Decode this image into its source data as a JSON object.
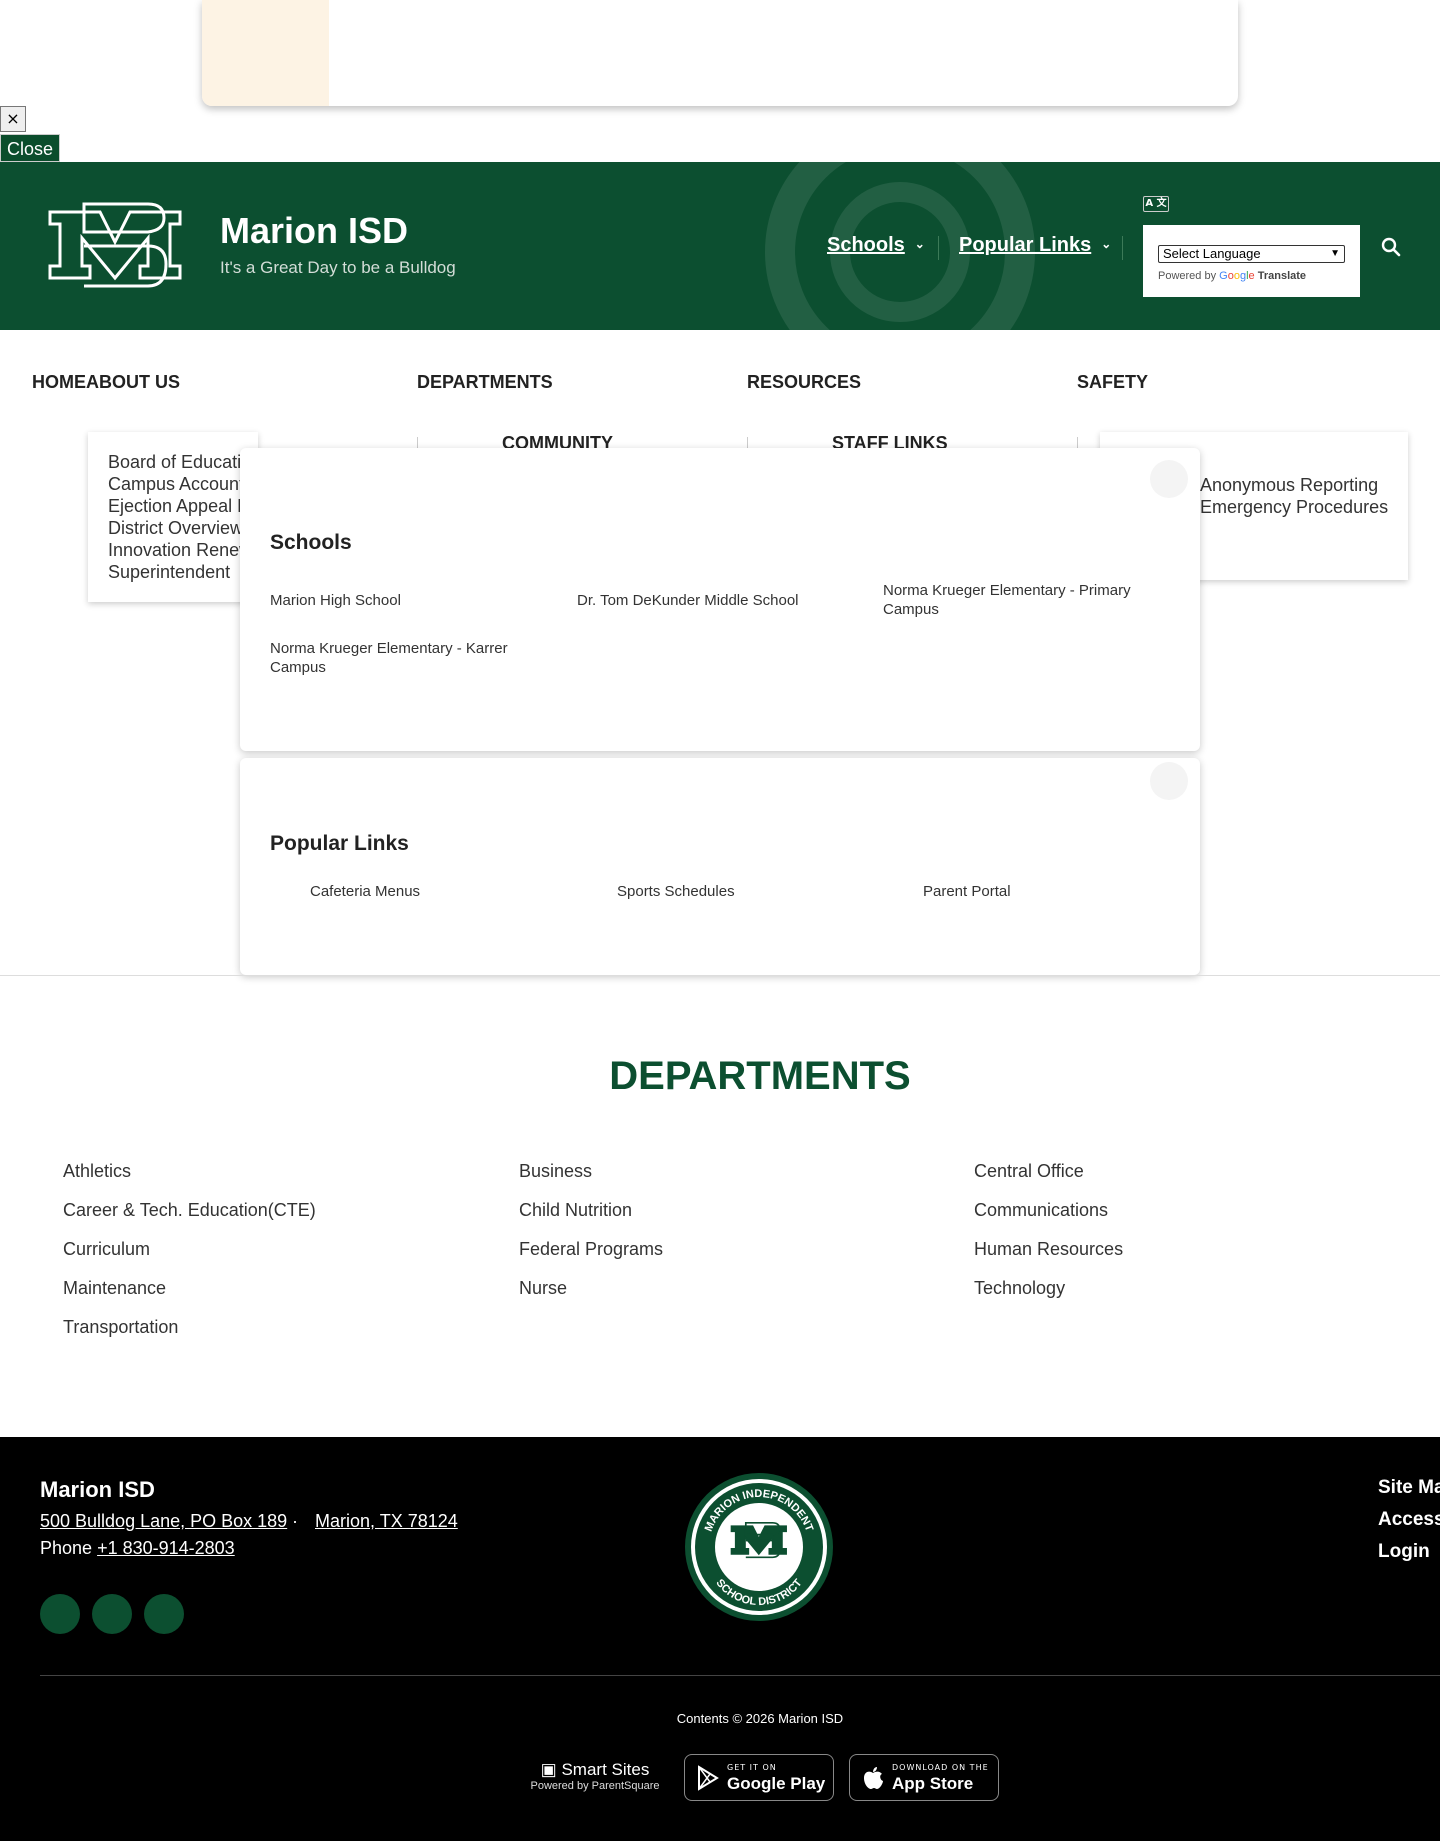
{
  "alert": {
    "close_x": "×",
    "close_label": "Close"
  },
  "header": {
    "site_name": "Marion ISD",
    "tagline": "It's a Great Day to be a Bulldog",
    "nav": [
      {
        "label": "Schools",
        "icon": "chevron-down-icon"
      },
      {
        "label": "Popular Links",
        "icon": "chevron-down-icon"
      }
    ],
    "translate": {
      "icon_text": "A 文",
      "select_value": "Select Language",
      "powered_by": "Powered by",
      "google": [
        "G",
        "o",
        "o",
        "g",
        "l",
        "e"
      ],
      "translate_label": "Translate"
    },
    "colors": {
      "header_bg": "#0c4f30",
      "accent": "#0c4f30"
    }
  },
  "main_nav": {
    "row1": [
      "HOMEABOUT US",
      "DEPARTMENTS",
      "RESOURCES",
      "SAFETY"
    ],
    "row2": [
      "COMMUNITY",
      "STAFF LINKS"
    ]
  },
  "about_dropdown": [
    "Board of Education",
    "Campus Accountability",
    "Ejection Appeal Process",
    "District Overview",
    "Innovation Renewal",
    "Superintendent"
  ],
  "safety_dropdown": [
    "Anonymous Reporting",
    "Emergency Procedures"
  ],
  "schools_panel": {
    "title": "Schools",
    "links": [
      "Marion High School",
      "Dr. Tom DeKunder Middle School",
      "Norma Krueger Elementary - Primary Campus",
      "Norma Krueger Elementary - Karrer Campus"
    ]
  },
  "popular_panel": {
    "title": "Popular Links",
    "links": [
      "Cafeteria Menus",
      "Sports Schedules",
      "Parent Portal"
    ]
  },
  "departments": {
    "title": "DEPARTMENTS",
    "col1": [
      "Athletics",
      "Career & Tech. Education(CTE)",
      "Curriculum",
      "Maintenance",
      "Transportation"
    ],
    "col2": [
      "Business",
      "Child Nutrition",
      "Federal Programs",
      "Nurse"
    ],
    "col3": [
      "Central Office",
      "Communications",
      "Human Resources",
      "Technology"
    ]
  },
  "footer": {
    "name": "Marion ISD",
    "address1": "500 Bulldog Lane, PO Box 189",
    "separator": "·",
    "address2": "Marion, TX 78124",
    "phone_label": "Phone",
    "phone": "+1 830-914-2803",
    "links": [
      "Site Map",
      "Accessibility",
      "Login"
    ],
    "seal_text_top": "MARION INDEPENDENT",
    "seal_text_bottom": "SCHOOL DISTRICT",
    "copyright": "Contents © 2026 Marion ISD",
    "smart_sites": "Smart Sites",
    "powered_by": "Powered by ParentSquare",
    "google_play_small": "GET IT ON",
    "google_play": "Google Play",
    "app_store_small": "DOWNLOAD ON THE",
    "app_store": "App Store"
  }
}
